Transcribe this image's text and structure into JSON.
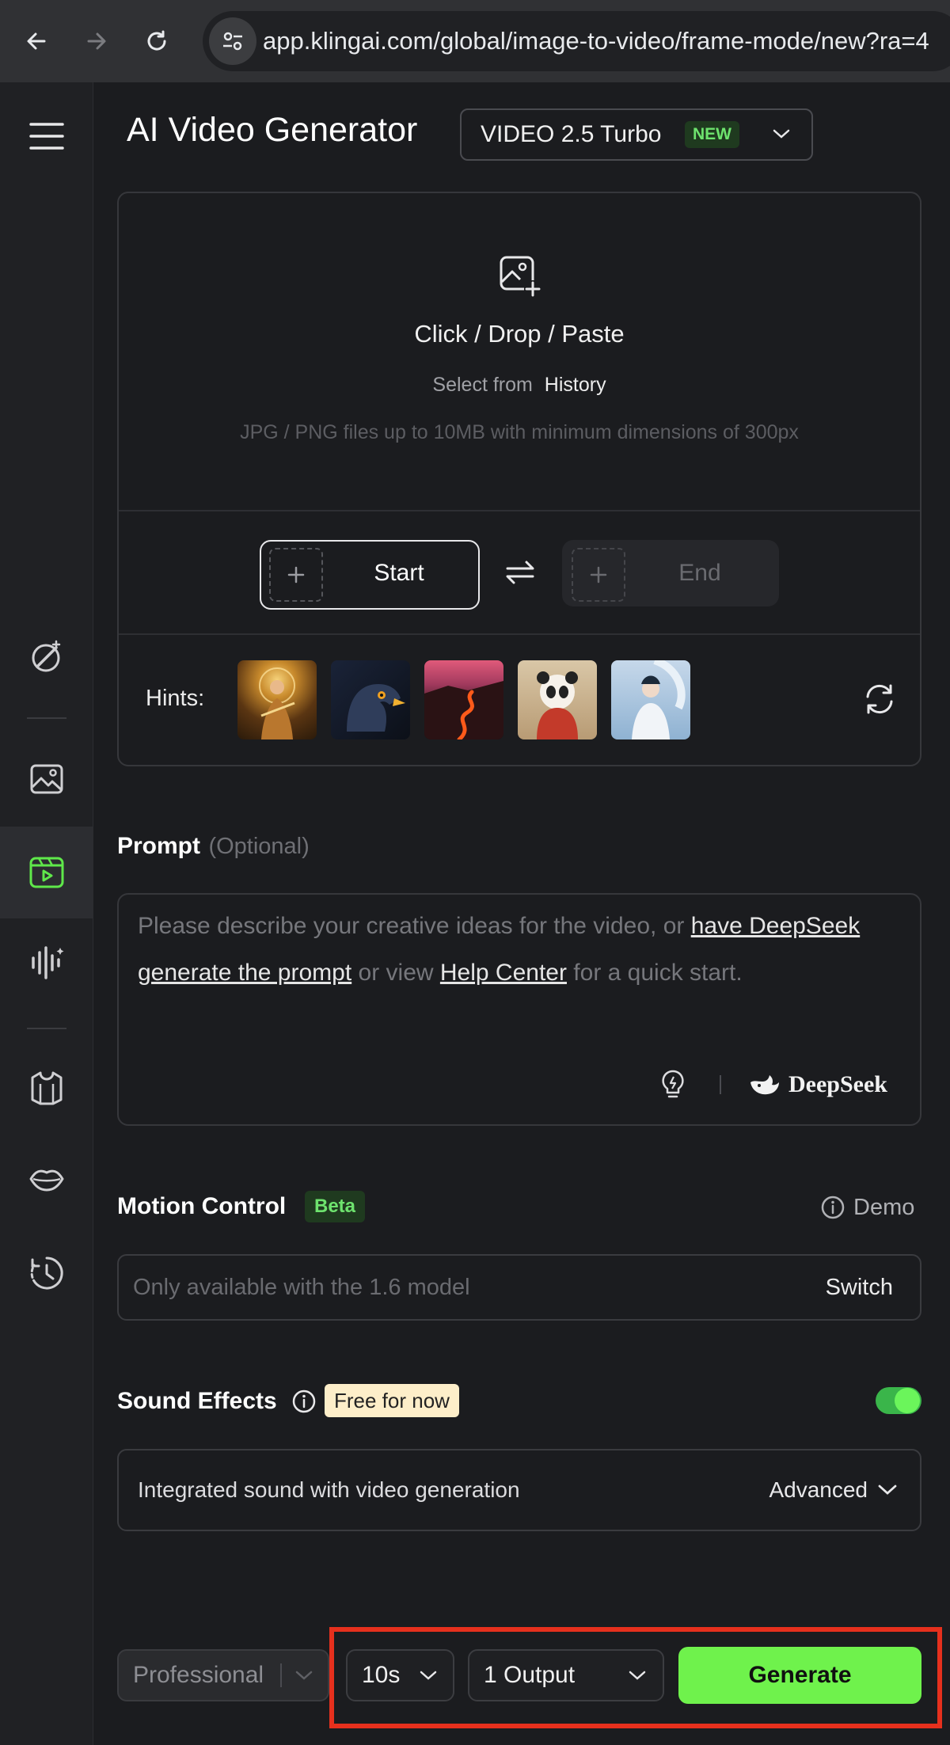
{
  "browser": {
    "url": "app.klingai.com/global/image-to-video/frame-mode/new?ra=4"
  },
  "header": {
    "title": "AI Video Generator",
    "model": {
      "label": "VIDEO 2.5 Turbo",
      "badge": "NEW"
    }
  },
  "sidebar": {
    "icons": [
      "menu-icon",
      "magic-edit-icon",
      "image-icon",
      "video-icon",
      "audio-icon",
      "shirt-icon",
      "lips-icon",
      "history-icon"
    ],
    "active": "video-icon"
  },
  "upload": {
    "title": "Click / Drop / Paste",
    "select_from": "Select from",
    "history": "History",
    "requirements": "JPG / PNG files up to 10MB with minimum dimensions of 300px",
    "start_label": "Start",
    "end_label": "End",
    "hints_label": "Hints:",
    "hints": [
      "golden-goddess-thumbnail",
      "eagle-thumbnail",
      "lava-river-thumbnail",
      "panda-thumbnail",
      "dragon-warrior-thumbnail"
    ]
  },
  "prompt": {
    "title": "Prompt",
    "optional": "(Optional)",
    "text_1": "Please describe your creative ideas for the video, or ",
    "link_1": "have DeepSeek generate the prompt",
    "text_2": " or view ",
    "link_2": "Help Center",
    "text_3": " for a quick start.",
    "brand": "DeepSeek"
  },
  "motion": {
    "title": "Motion Control",
    "badge": "Beta",
    "demo": "Demo",
    "placeholder": "Only available with the 1.6 model",
    "switch": "Switch"
  },
  "sound": {
    "title": "Sound Effects",
    "badge": "Free for now",
    "enabled": true,
    "description": "Integrated sound with video generation",
    "advanced": "Advanced"
  },
  "bottom": {
    "mode": "Professional",
    "duration": "10s",
    "outputs": "1 Output",
    "generate": "Generate"
  },
  "colors": {
    "accent": "#6ff24c",
    "highlight": "#e6301d",
    "background": "#1b1c1f"
  }
}
